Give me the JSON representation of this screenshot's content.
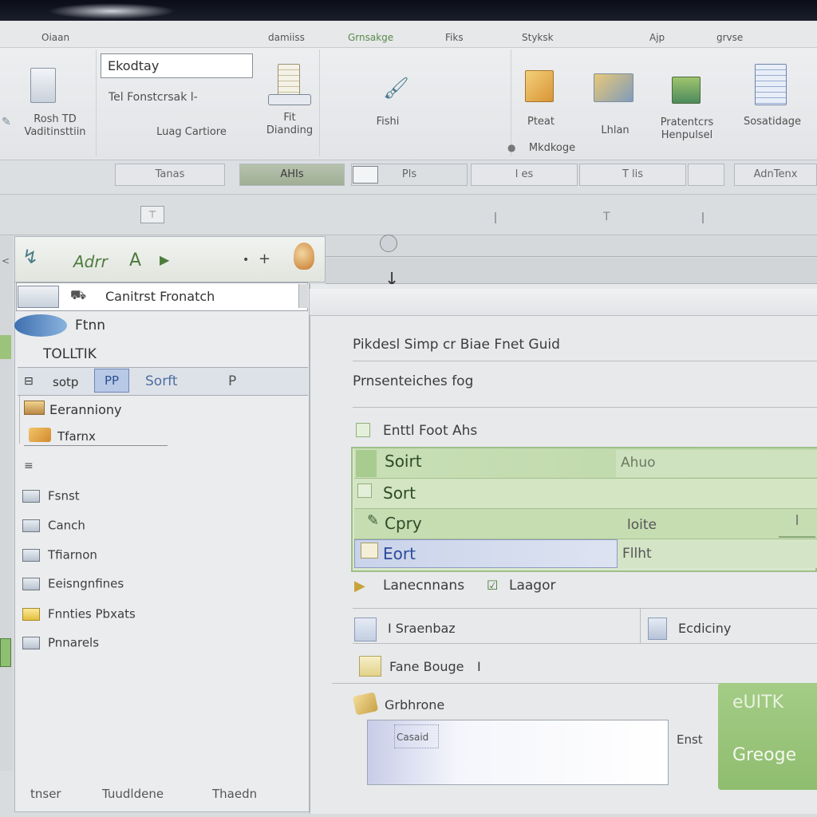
{
  "menu": [
    "Oiaan",
    "damiiss",
    "Grnsakge",
    "Fiks",
    "Styksk",
    "Ajp",
    "grvse"
  ],
  "ribbon": {
    "name_box": "Ekodtay",
    "formula_label": "Tel Fonstcrsak l-",
    "groups": [
      {
        "label": "Rosh TD\nVaditinsttiin"
      },
      {
        "label": "Luag Cartiore"
      },
      {
        "label": "Fit\nDianding"
      },
      {
        "label": "Fishi"
      },
      {
        "label": "Pteat"
      },
      {
        "label": "Mkdkoge"
      },
      {
        "label": "Lhlan"
      },
      {
        "label": "Pratentcrs\nHenpulsel"
      },
      {
        "label": "Sosatidage"
      }
    ]
  },
  "tabs": [
    "Tanas",
    "AHIs",
    "Pls",
    "l es",
    "T lis",
    "AdnTenx"
  ],
  "left_panel": {
    "header_title": "Adrr",
    "header_letter": "A",
    "header_sign": "+",
    "subheader": "Canitrst Fronatch",
    "row_a": "Ftnn",
    "row_b": "TOLLTIK",
    "toolbar": [
      "sotp",
      "PP",
      "Sorft",
      "P"
    ],
    "tree": [
      "Eeranniony",
      "Tfarnx"
    ],
    "items": [
      "Fsnst",
      "Canch",
      "Tfiarnon",
      "Eeisngnfines",
      "Fnnties Pbxats",
      "Pnnarels"
    ],
    "footer": [
      "tnser",
      "Tuudldene",
      "Thaedn"
    ]
  },
  "right_panel": {
    "line1": "Pikdesl Simp cr Biae Fnet Guid",
    "line2": "Prnsenteiches fog",
    "check_label": "Enttl Foot Ahs",
    "grid_rows": [
      {
        "left": "Soirt",
        "right": "Ahuo"
      },
      {
        "left": "Sort",
        "right": ""
      },
      {
        "left": "Cpry",
        "right": "loite"
      },
      {
        "left": "Eort",
        "right": "Fllht"
      }
    ],
    "legend_a": "Lanecnnans",
    "legend_b": "Laagor",
    "row_s1": "I  Sraenbaz",
    "row_s2": "Ecdiciny",
    "row_frame": "Fane Bouge",
    "grid_label": "Grbhrone",
    "preview_text": "Casaid",
    "preview_side": "Enst",
    "badge_top": "eUITK",
    "badge_bottom": "Greoge"
  }
}
